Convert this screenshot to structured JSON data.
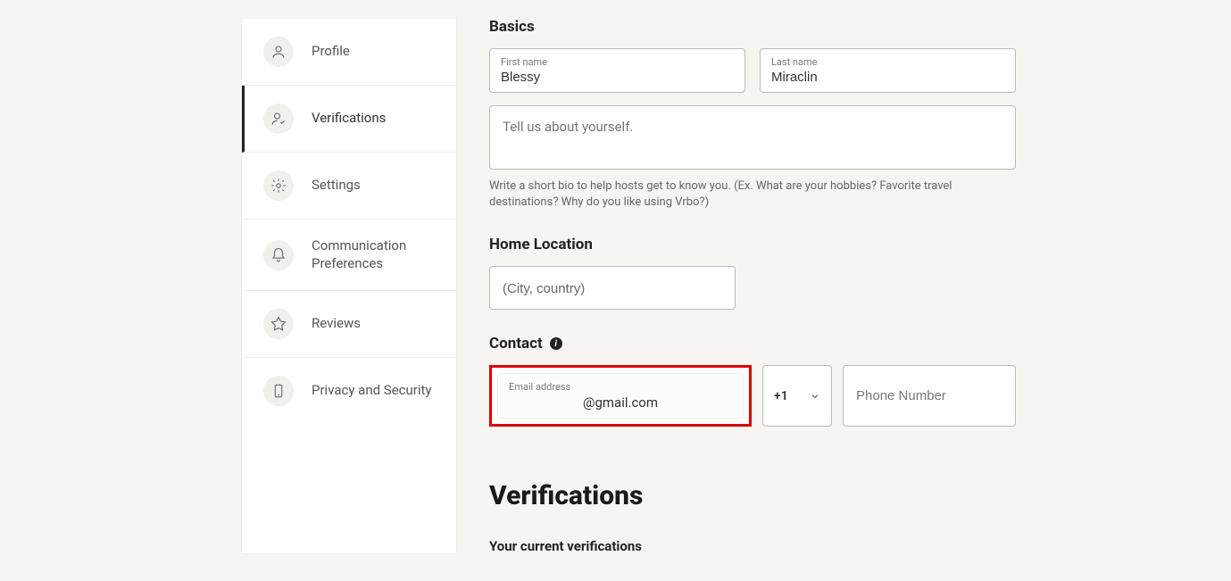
{
  "sidebar": {
    "items": [
      {
        "label": "Profile"
      },
      {
        "label": "Verifications"
      },
      {
        "label": "Settings"
      },
      {
        "label": "Communication Preferences"
      },
      {
        "label": "Reviews"
      },
      {
        "label": "Privacy and Security"
      }
    ]
  },
  "basics": {
    "title": "Basics",
    "first_name_label": "First name",
    "first_name_value": "Blessy",
    "last_name_label": "Last name",
    "last_name_value": "Miraclin",
    "bio_placeholder": "Tell us about yourself.",
    "bio_helper": "Write a short bio to help hosts get to know you. (Ex. What are your hobbies? Favorite travel destinations? Why do you like using Vrbo?)"
  },
  "home": {
    "title": "Home Location",
    "placeholder": "(City, country)"
  },
  "contact": {
    "title": "Contact",
    "email_label": "Email address",
    "email_value": "@gmail.com",
    "country_code": "+1",
    "phone_placeholder": "Phone Number"
  },
  "verifications": {
    "title": "Verifications",
    "sub": "Your current verifications"
  }
}
